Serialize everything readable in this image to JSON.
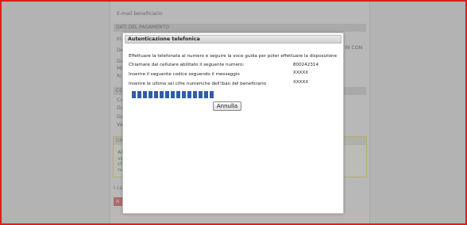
{
  "background_form": {
    "top_label": "E-mail beneficiario",
    "section_payment": "DATI DEL PAGAMENTO",
    "row_prefixes": [
      "In",
      "De",
      "Da",
      "Mi",
      "Ri"
    ],
    "right_fragment": "IN CON",
    "section_co": "CO",
    "co_prefixes": [
      "Co",
      "Da",
      "Da",
      "Va"
    ],
    "yellow_section": "DA",
    "yellow_prefixes": [
      "Al",
      "ve",
      "ch",
      "nu"
    ],
    "bottom_text": "I cal",
    "red_button_label": "A"
  },
  "modal": {
    "title": "Autenticazione telefonica",
    "instruction": "Effettuare la telefonata al numero e seguire la voce guida per poter effettuare la disposizione",
    "rows": [
      {
        "label": "Chiamare dal cellulare abilitato il seguente numero:",
        "value": "800242314"
      },
      {
        "label": "Inserire il seguente codice seguendo il messaggio",
        "value": "XXXXX"
      },
      {
        "label": "Inserire le ultime sei cifre numeriche dell'iban del beneficiario",
        "value": "XXXXX"
      }
    ],
    "progress_segments": 15,
    "cancel_label": "Annulla"
  },
  "colors": {
    "progress_fill": "#2f5daa",
    "frame_border": "#e11b1b",
    "yellow_border": "#e9dc6a"
  }
}
